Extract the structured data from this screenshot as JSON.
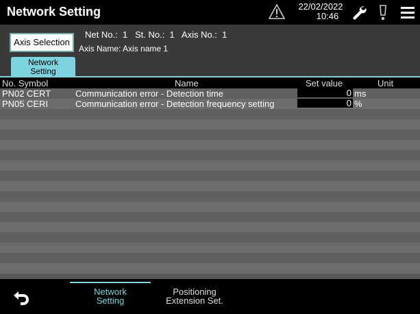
{
  "header": {
    "title": "Network Setting",
    "date": "22/02/2022",
    "time": "10:46"
  },
  "axis_panel": {
    "axis_selection_label": "Axis Selection",
    "net_info": "Net No.:  1   St. No.:  1   Axis No.:  1",
    "axis_name": "Axis Name: Axis name 1"
  },
  "tab": {
    "line1": "Network",
    "line2": "Setting"
  },
  "table": {
    "headers": {
      "no_symbol": "No.  Symbol",
      "name": "Name",
      "set_value": "Set value",
      "unit": "Unit"
    },
    "rows": [
      {
        "no": "PN02",
        "symbol": "CERT",
        "name": "Communication error - Detection time",
        "value": "0",
        "unit": "ms"
      },
      {
        "no": "PN05",
        "symbol": "CERI",
        "name": "Communication error - Detection frequency setting",
        "value": "0",
        "unit": "%"
      }
    ]
  },
  "bottom_tabs": [
    {
      "line1": "Network",
      "line2": "Setting",
      "active": true
    },
    {
      "line1": "Positioning",
      "line2": "Extension Set.",
      "active": false
    }
  ],
  "colors": {
    "accent": "#7dd3e0",
    "row_odd": "#606060",
    "row_even": "#6c6c6c"
  }
}
